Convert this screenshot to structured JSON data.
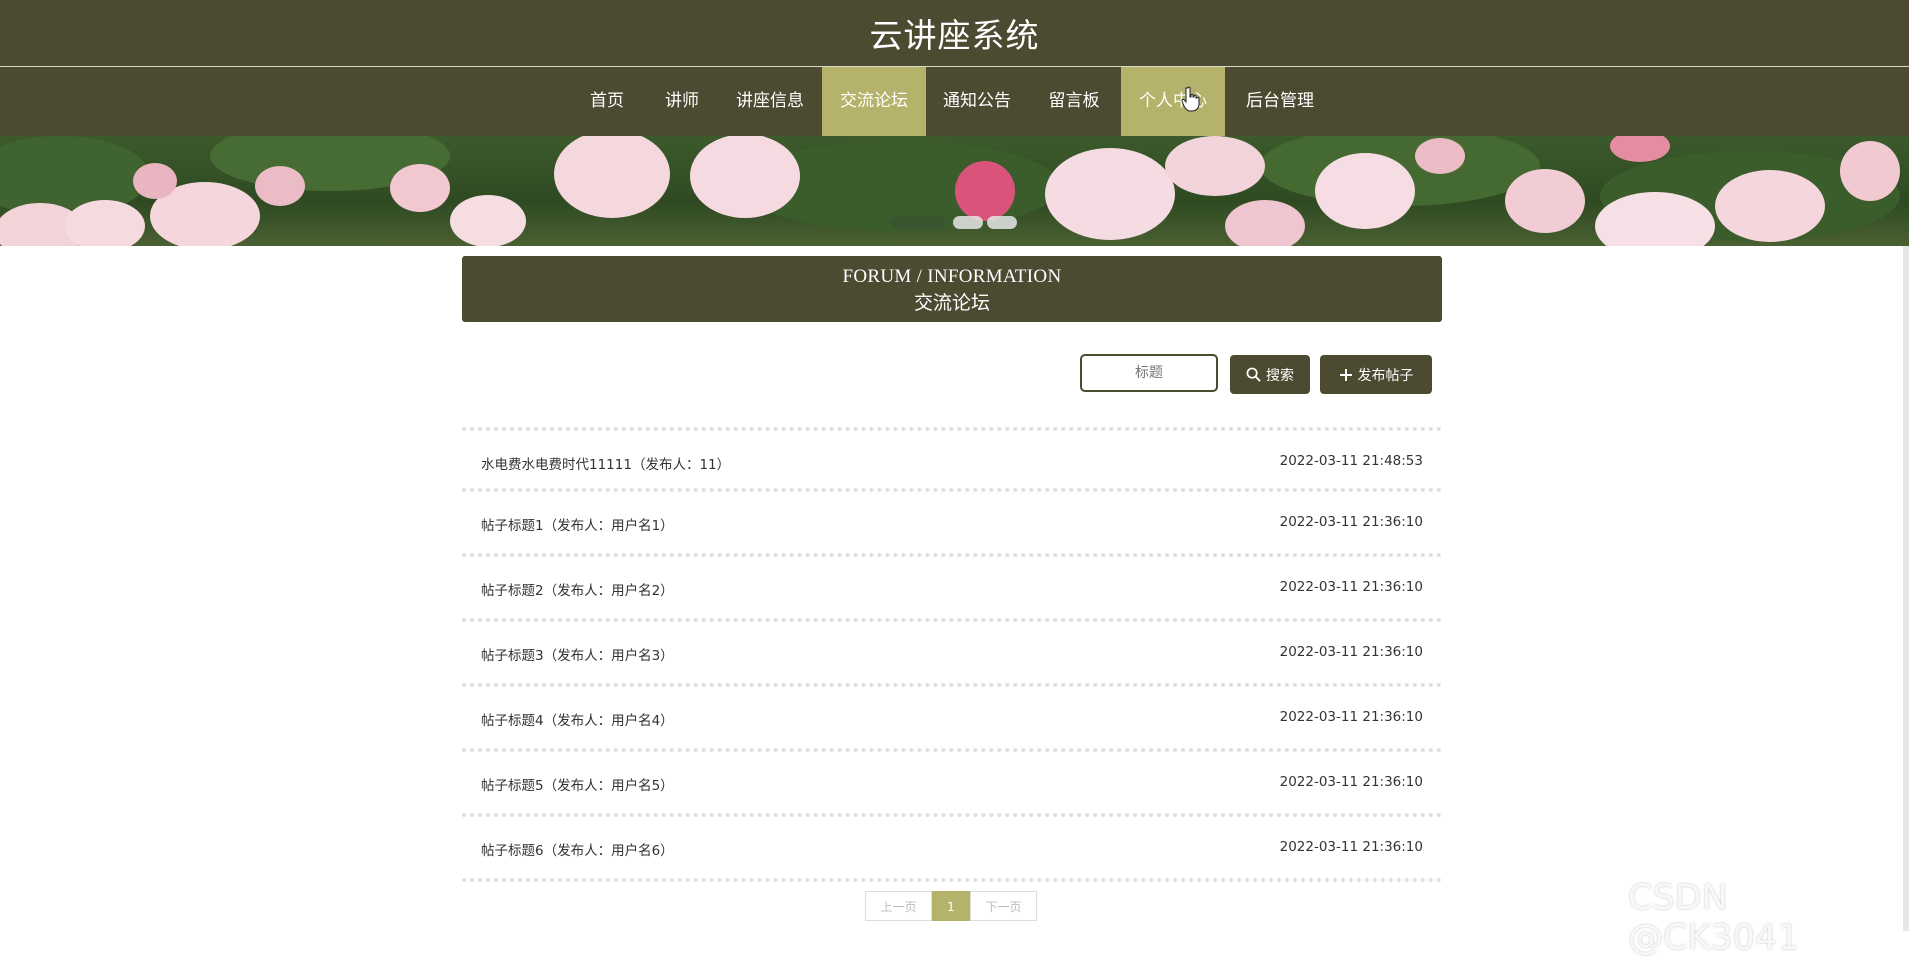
{
  "site": {
    "title": "云讲座系统"
  },
  "nav": {
    "items": [
      {
        "label": "首页"
      },
      {
        "label": "讲师"
      },
      {
        "label": "讲座信息"
      },
      {
        "label": "交流论坛"
      },
      {
        "label": "通知公告"
      },
      {
        "label": "留言板"
      },
      {
        "label": "个人中心"
      },
      {
        "label": "后台管理"
      }
    ],
    "active": "交流论坛",
    "hovered": "个人中心"
  },
  "section": {
    "title_en": "FORUM / INFORMATION",
    "title_cn": "交流论坛"
  },
  "search": {
    "placeholder": "标题",
    "search_label": "搜索",
    "publish_label": "发布帖子",
    "search_icon": "search-icon",
    "publish_icon": "plus-icon"
  },
  "posts": [
    {
      "title": "水电费水电费时代11111（发布人：11）",
      "time": "2022-03-11 21:48:53"
    },
    {
      "title": "帖子标题1（发布人：用户名1）",
      "time": "2022-03-11 21:36:10"
    },
    {
      "title": "帖子标题2（发布人：用户名2）",
      "time": "2022-03-11 21:36:10"
    },
    {
      "title": "帖子标题3（发布人：用户名3）",
      "time": "2022-03-11 21:36:10"
    },
    {
      "title": "帖子标题4（发布人：用户名4）",
      "time": "2022-03-11 21:36:10"
    },
    {
      "title": "帖子标题5（发布人：用户名5）",
      "time": "2022-03-11 21:36:10"
    },
    {
      "title": "帖子标题6（发布人：用户名6）",
      "time": "2022-03-11 21:36:10"
    }
  ],
  "pagination": {
    "prev": "上一页",
    "current": "1",
    "next": "下一页"
  },
  "watermark": "CSDN @CK3041",
  "colors": {
    "primary": "#4d4a32",
    "accent": "#b5b36b"
  }
}
